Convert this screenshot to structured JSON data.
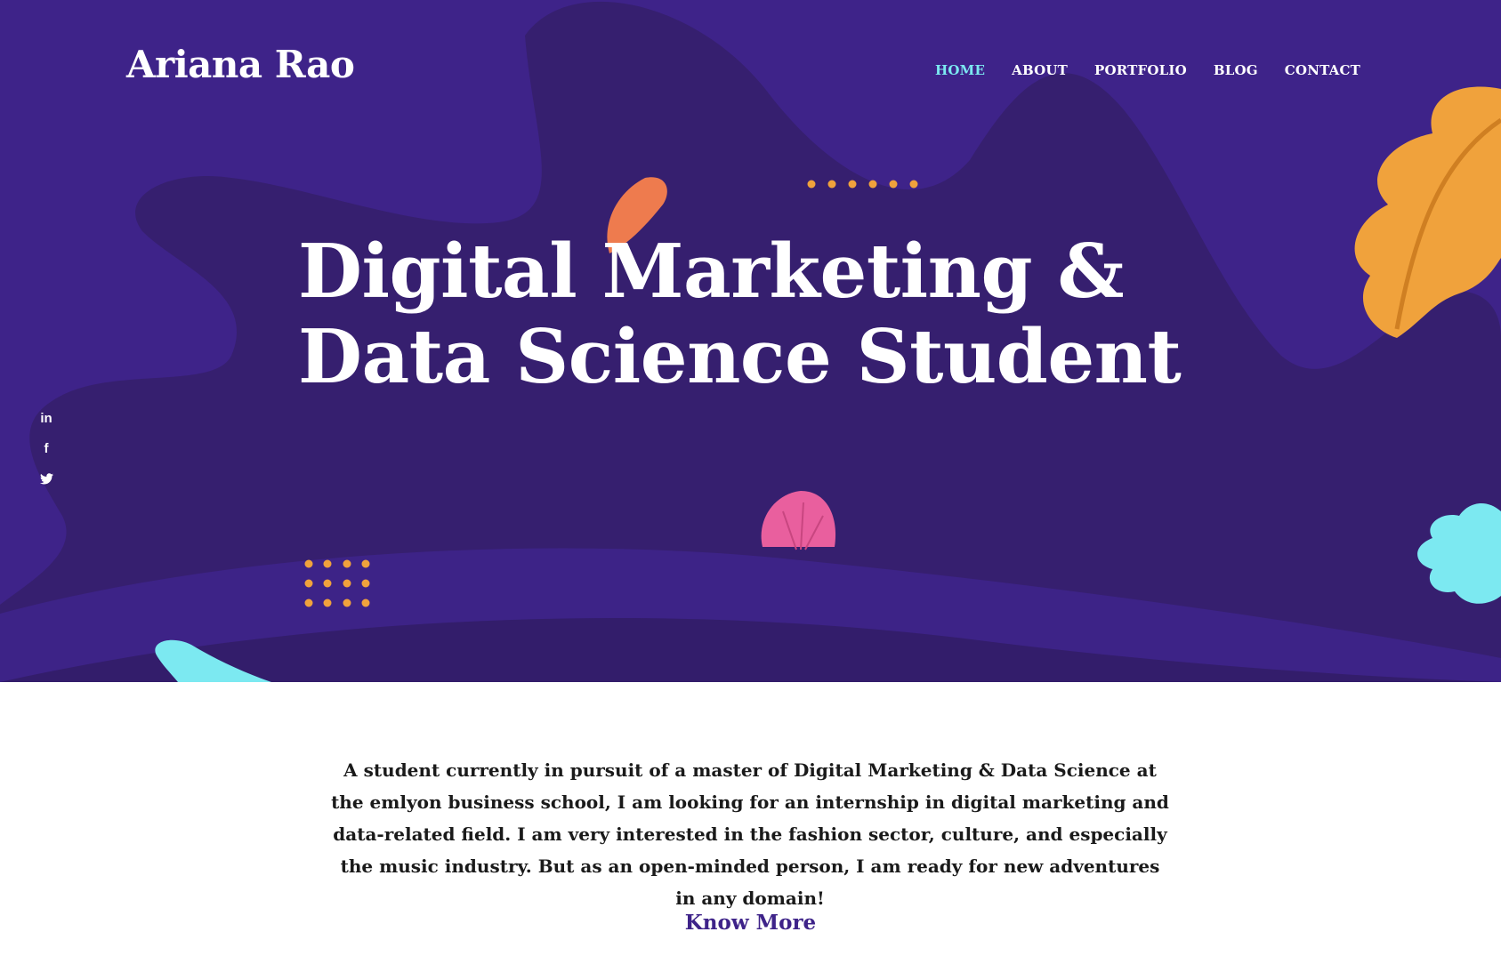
{
  "site": {
    "name": "Ariana Rao"
  },
  "nav": {
    "items": [
      {
        "label": "HOME",
        "active": true
      },
      {
        "label": "ABOUT",
        "active": false
      },
      {
        "label": "PORTFOLIO",
        "active": false
      },
      {
        "label": "BLOG",
        "active": false
      },
      {
        "label": "CONTACT",
        "active": false
      }
    ]
  },
  "hero": {
    "headline_line1": "Digital Marketing &",
    "headline_line2": "Data Science Student"
  },
  "social": {
    "linkedin": "in",
    "facebook": "f",
    "twitter_icon": "twitter-icon"
  },
  "intro": {
    "text": "A student currently in pursuit of a master of Digital Marketing & Data Science at the emlyon business school, I am looking for an internship in digital marketing and data-related field. I am very interested in the fashion sector, culture, and especially the music industry. But as an open-minded person, I am ready for new adventures in any domain!",
    "cta": "Know More"
  },
  "colors": {
    "hero_bg": "#3e2389",
    "hero_blob": "#361f6f",
    "accent_cyan": "#7ce9f1",
    "accent_orange": "#f0a23c",
    "accent_coral": "#ee7b4e",
    "accent_pink": "#e95f9e"
  }
}
